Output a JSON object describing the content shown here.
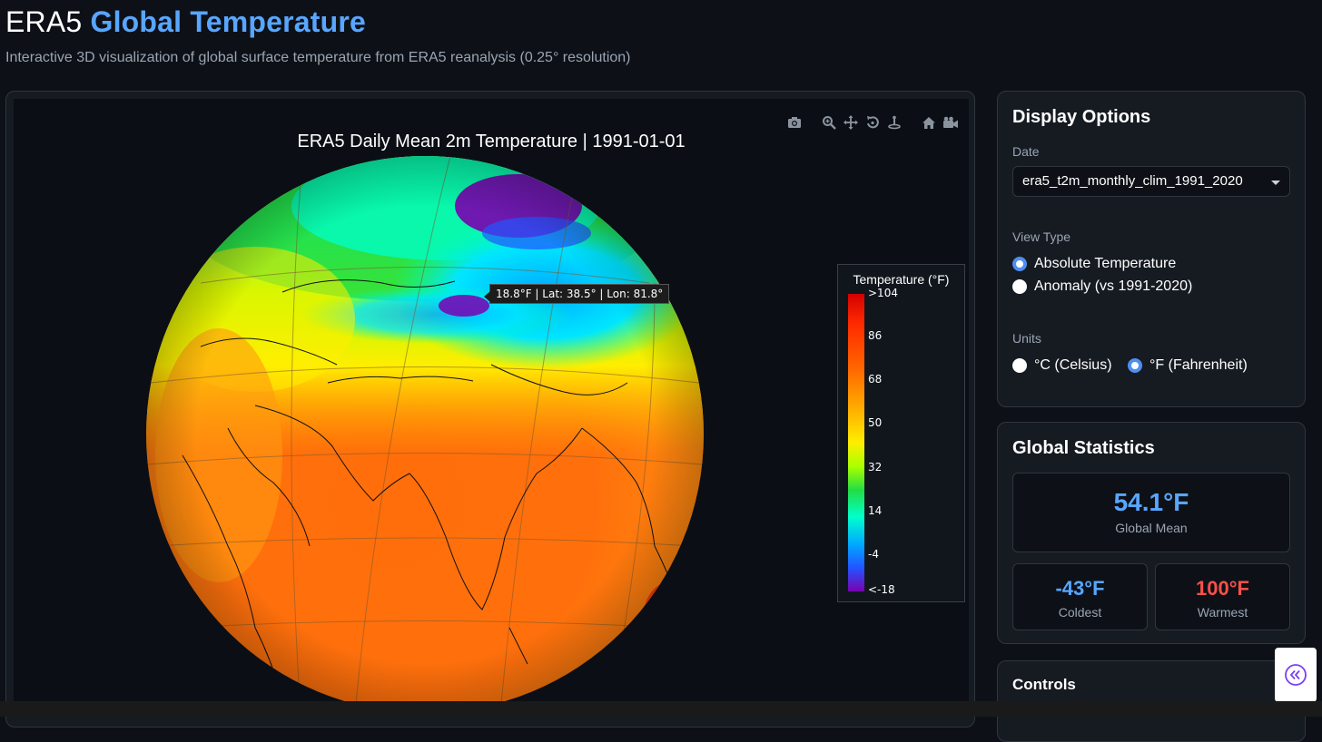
{
  "header": {
    "title_prefix": "ERA5",
    "title_accent": "Global Temperature",
    "subtitle": "Interactive 3D visualization of global surface temperature from ERA5 reanalysis (0.25° resolution)"
  },
  "plot": {
    "title": "ERA5 Daily Mean 2m Temperature | 1991-01-01",
    "tooltip": "18.8°F | Lat: 38.5° | Lon: 81.8°",
    "modebar_icons": [
      "camera-icon",
      "zoom-icon",
      "pan-icon",
      "orbit-rotation-icon",
      "turntable-rotation-icon",
      "reset-camera-home-icon",
      "camera-last-save-icon"
    ]
  },
  "colorbar": {
    "title": "Temperature (°F)",
    "ticks": [
      ">104",
      "86",
      "68",
      "50",
      "32",
      "14",
      "-4",
      "<-18"
    ]
  },
  "display_options": {
    "heading": "Display Options",
    "date_label": "Date",
    "date_value": "era5_t2m_monthly_clim_1991_2020",
    "view_type_label": "View Type",
    "view_types": [
      {
        "label": "Absolute Temperature",
        "selected": true
      },
      {
        "label": "Anomaly (vs 1991-2020)",
        "selected": false
      }
    ],
    "units_label": "Units",
    "units": [
      {
        "label": "°C (Celsius)",
        "selected": false
      },
      {
        "label": "°F (Fahrenheit)",
        "selected": true
      }
    ]
  },
  "stats": {
    "heading": "Global Statistics",
    "mean_value": "54.1°F",
    "mean_label": "Global Mean",
    "coldest_value": "-43°F",
    "coldest_label": "Coldest",
    "warmest_value": "100°F",
    "warmest_label": "Warmest"
  },
  "controls": {
    "heading": "Controls"
  },
  "colors": {
    "accent_blue": "#58a6ff",
    "warm_red": "#f85149",
    "background": "#0d1117",
    "panel": "#161b22"
  }
}
